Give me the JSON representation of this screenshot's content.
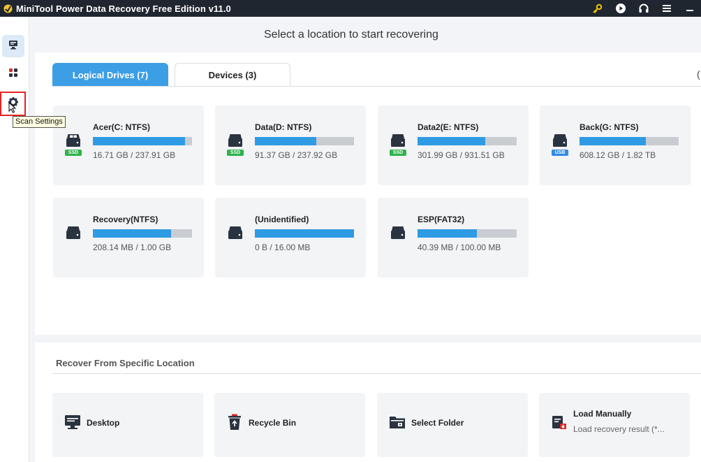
{
  "app": {
    "title": "MiniTool Power Data Recovery Free Edition v11.0",
    "accent": "#3c9ee5",
    "toolbar_icons": [
      "key-icon",
      "play-circle-icon",
      "headset-icon",
      "menu-icon",
      "minimize-icon"
    ]
  },
  "sidebar": {
    "items": [
      {
        "name": "this-pc-icon",
        "active": true
      },
      {
        "name": "apps-grid-icon",
        "active": false
      },
      {
        "name": "gear-icon",
        "active": false,
        "highlighted": true
      }
    ],
    "tooltip": "Scan Settings"
  },
  "header": {
    "title": "Select a location to start recovering"
  },
  "tabs": [
    {
      "label": "Logical Drives (7)",
      "active": true
    },
    {
      "label": "Devices (3)",
      "active": false
    }
  ],
  "edge_glyph": "(",
  "drives": [
    {
      "name": "Acer(C: NTFS)",
      "size": "16.71 GB / 237.91 GB",
      "fill": 0.93,
      "badge": "SSD",
      "badge_color": "#2db34a",
      "icon": "windows-drive-icon"
    },
    {
      "name": "Data(D: NTFS)",
      "size": "91.37 GB / 237.92 GB",
      "fill": 0.62,
      "badge": "SSD",
      "badge_color": "#2db34a",
      "icon": "drive-icon"
    },
    {
      "name": "Data2(E: NTFS)",
      "size": "301.99 GB / 931.51 GB",
      "fill": 0.68,
      "badge": "SSD",
      "badge_color": "#2db34a",
      "icon": "drive-icon"
    },
    {
      "name": "Back(G: NTFS)",
      "size": "608.12 GB / 1.82 TB",
      "fill": 0.67,
      "badge": "USB",
      "badge_color": "#2f8be4",
      "icon": "drive-icon"
    },
    {
      "name": "Recovery(NTFS)",
      "size": "208.14 MB / 1.00 GB",
      "fill": 0.79,
      "badge": "",
      "badge_color": "",
      "icon": "drive-icon"
    },
    {
      "name": "(Unidentified)",
      "size": "0 B / 16.00 MB",
      "fill": 1.0,
      "badge": "",
      "badge_color": "",
      "icon": "drive-icon"
    },
    {
      "name": "ESP(FAT32)",
      "size": "40.39 MB / 100.00 MB",
      "fill": 0.6,
      "badge": "",
      "badge_color": "",
      "icon": "drive-icon"
    }
  ],
  "specific": {
    "title": "Recover From Specific Location",
    "items": [
      {
        "label": "Desktop",
        "sub": "",
        "icon": "desktop-icon"
      },
      {
        "label": "Recycle Bin",
        "sub": "",
        "icon": "recycle-bin-icon"
      },
      {
        "label": "Select Folder",
        "sub": "",
        "icon": "folder-icon"
      },
      {
        "label": "Load Manually",
        "sub": "Load recovery result (*...",
        "icon": "load-file-icon"
      }
    ]
  }
}
